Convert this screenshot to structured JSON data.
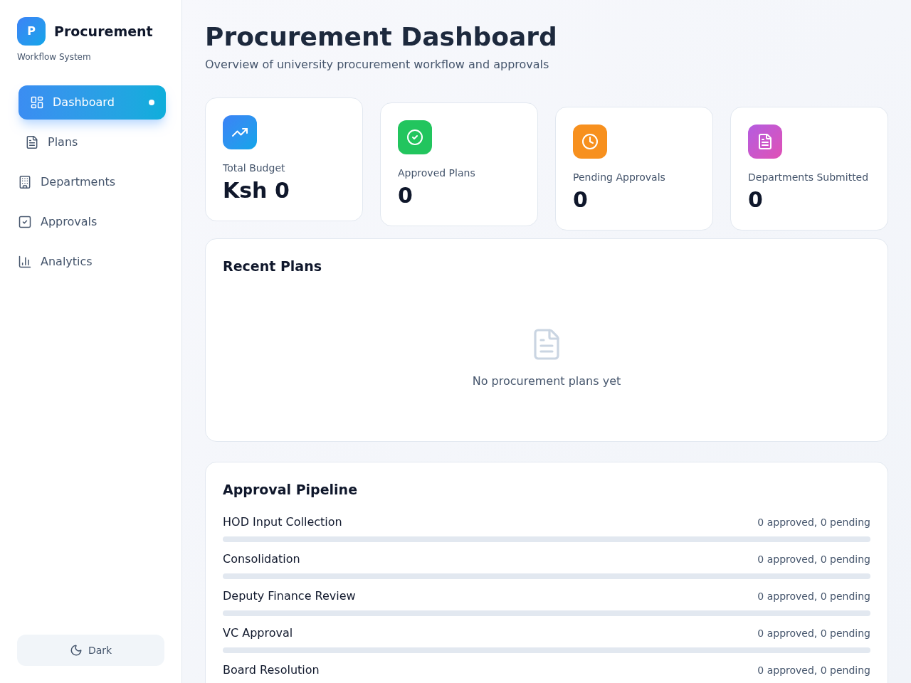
{
  "sidebar": {
    "logo_letter": "P",
    "title": "Procurement",
    "subtitle": "Workflow System",
    "nav": [
      {
        "label": "Dashboard",
        "selected": true
      },
      {
        "label": "Plans",
        "selected": false
      },
      {
        "label": "Departments",
        "selected": false
      },
      {
        "label": "Approvals",
        "selected": false
      },
      {
        "label": "Analytics",
        "selected": false
      }
    ],
    "theme_button": {
      "label": "Dark"
    }
  },
  "header": {
    "title": "Procurement Dashboard",
    "subtitle": "Overview of university procurement workflow and approvals"
  },
  "stats": [
    {
      "label": "Total Budget",
      "value": "Ksh 0"
    },
    {
      "label": "Approved Plans",
      "value": "0"
    },
    {
      "label": "Pending Approvals",
      "value": "0"
    },
    {
      "label": "Departments Submitted",
      "value": "0"
    }
  ],
  "recent_plans": {
    "title": "Recent Plans",
    "empty_text": "No procurement plans yet"
  },
  "pipeline": {
    "title": "Approval Pipeline",
    "stages": [
      {
        "name": "HOD Input Collection",
        "summary": "0 approved, 0 pending"
      },
      {
        "name": "Consolidation",
        "summary": "0 approved, 0 pending"
      },
      {
        "name": "Deputy Finance Review",
        "summary": "0 approved, 0 pending"
      },
      {
        "name": "VC Approval",
        "summary": "0 approved, 0 pending"
      },
      {
        "name": "Board Resolution",
        "summary": "0 approved, 0 pending"
      }
    ]
  }
}
